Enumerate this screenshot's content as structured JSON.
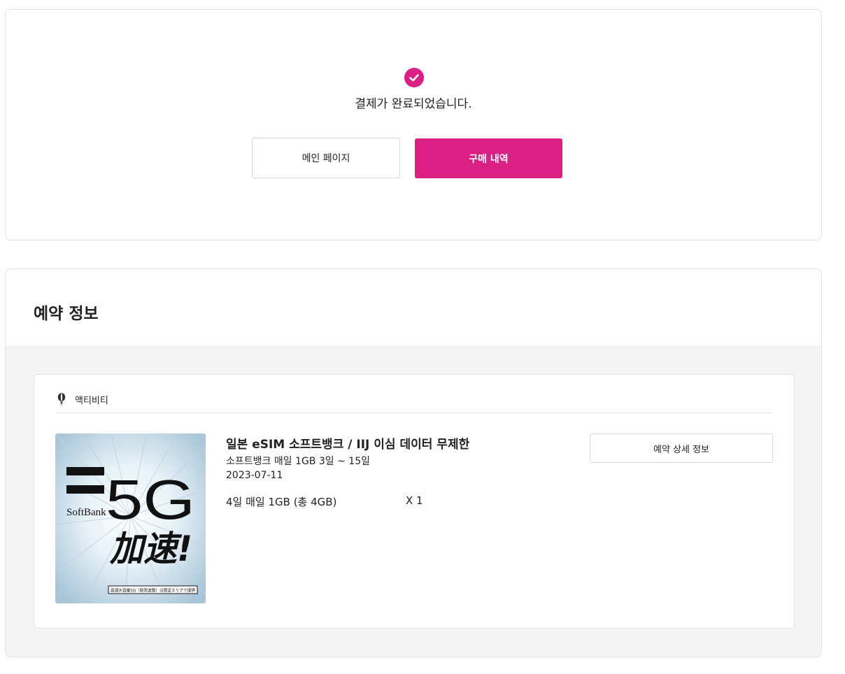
{
  "complete": {
    "message": "결제가 완료되었습니다.",
    "main_button": "메인 페이지",
    "history_button": "구매 내역"
  },
  "reservation": {
    "title": "예약 정보",
    "category": "액티비티",
    "product": {
      "name": "일본 eSIM 소프트뱅크 / IIJ 이심 데이터 무제한",
      "subtitle": "소프트뱅크 매일 1GB 3일 ~ 15일",
      "date": "2023-07-11",
      "option": "4일 매일 1GB (총 4GB)",
      "quantity": "X 1",
      "image": {
        "brand": "SoftBank",
        "headline": "5G",
        "subhead": "加速!",
        "footnote": "高速大容量5G（新周波数）は限定エリアで提供"
      }
    },
    "detail_button": "예약 상세 정보"
  },
  "colors": {
    "accent": "#dc1f85",
    "card_border": "#e1e1e1",
    "section_bg": "#f4f4f4"
  },
  "icons": {
    "complete": "check-circle-icon",
    "category": "balloon-icon"
  }
}
